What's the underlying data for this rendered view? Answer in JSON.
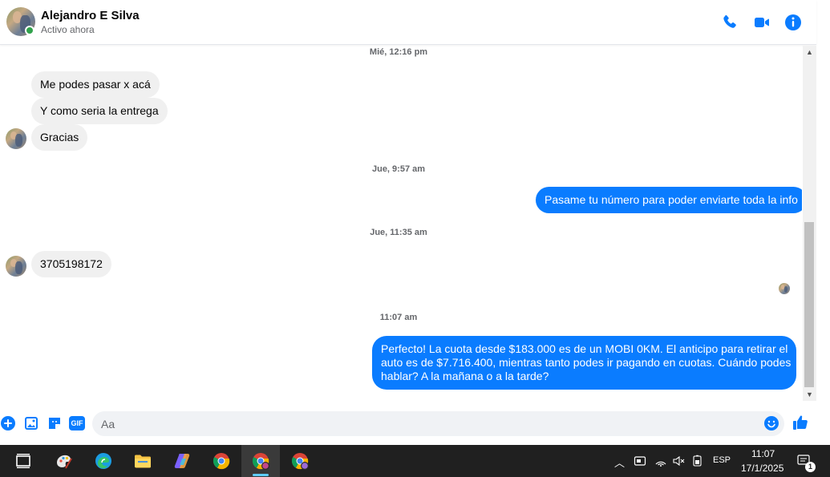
{
  "header": {
    "name": "Alejandro E Silva",
    "status": "Activo ahora",
    "icons": [
      "phone-icon",
      "video-icon",
      "info-icon"
    ],
    "accent_color": "#0a7cff"
  },
  "conversation": {
    "timestamps": [
      "Mié, 12:16 pm",
      "Jue, 9:57 am",
      "Jue, 11:35 am",
      "11:07 am"
    ],
    "incoming": [
      "Me podes pasar x acá",
      "Y como seria la entrega",
      "Gracias",
      "3705198172"
    ],
    "outgoing_1": "Pasame tu número para poder enviarte toda la info",
    "outgoing_2": [
      "Perfecto! La cuota desde $183.000 es de un MOBI 0KM. El anticipo para retirar el",
      "auto es de $7.716.400, mientras tanto podes ir pagando en cuotas. Cuándo podes",
      "hablar? A la mañana o a la tarde?"
    ]
  },
  "composer": {
    "placeholder": "Aa",
    "icons": [
      "plus-icon",
      "image-icon",
      "sticker-icon",
      "gif-icon",
      "emoji-icon",
      "like-icon"
    ],
    "gif_label": "GIF"
  },
  "taskbar": {
    "apps": [
      "task-view",
      "paint",
      "edge",
      "file-explorer",
      "copilot",
      "chrome",
      "chrome-profile-1",
      "chrome-profile-2"
    ],
    "language": "ESP",
    "time": "11:07",
    "date": "17/1/2025",
    "notification_count": "1"
  }
}
